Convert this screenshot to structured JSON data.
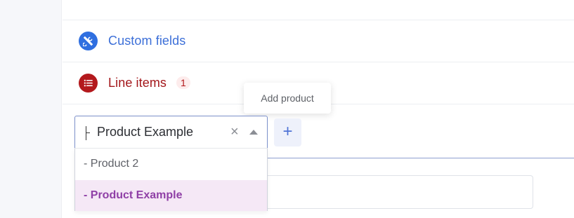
{
  "sections": {
    "custom_fields": {
      "title": "Custom fields",
      "icon": "tools-icon",
      "color": "#3c6fd8"
    },
    "line_items": {
      "title": "Line items",
      "count": "1",
      "icon": "list-icon",
      "color": "#a3161a"
    }
  },
  "tooltip": {
    "text": "Add product"
  },
  "product_select": {
    "value": "Product Example",
    "clear_symbol": "×",
    "options": [
      {
        "label": "- Product 2",
        "selected": false
      },
      {
        "label": "- Product Example",
        "selected": true
      }
    ],
    "selected_color": "#8f3fa6",
    "selected_bg": "#f5e8f6"
  },
  "add_button": {
    "symbol": "+",
    "color": "#4f73d6"
  }
}
